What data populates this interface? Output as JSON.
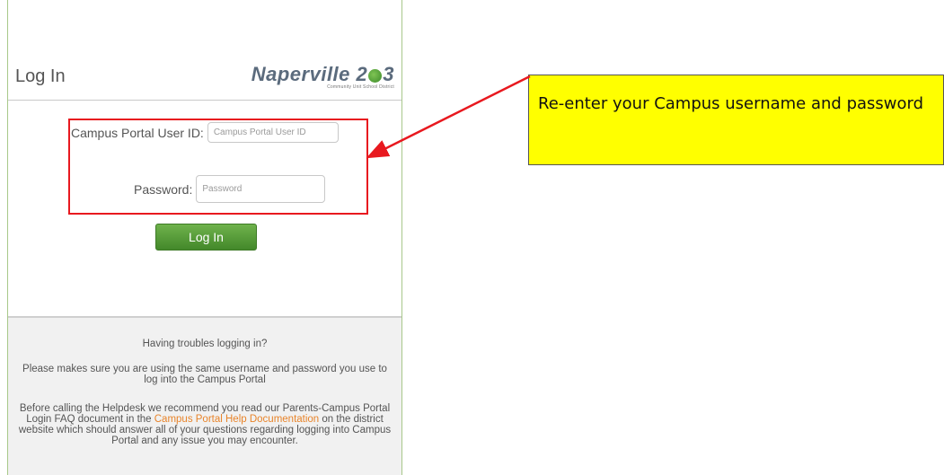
{
  "login": {
    "title": "Log In",
    "logo": {
      "brand_prefix": "Naperville 2",
      "brand_suffix": "3",
      "tagline": "Community Unit School District"
    },
    "user_id": {
      "label": "Campus Portal User ID:",
      "placeholder": "Campus Portal User ID",
      "value": ""
    },
    "password": {
      "label": "Password:",
      "placeholder": "Password",
      "value": ""
    },
    "button_label": "Log In"
  },
  "help": {
    "title": "Having troubles logging in?",
    "paragraph1": "Please makes sure you are using the same username and password you use to log into the Campus Portal",
    "paragraph2_before": "Before calling the Helpdesk we recommend you read our Parents-Campus Portal Login FAQ document in the ",
    "paragraph2_link": "Campus Portal Help Documentation",
    "paragraph2_after": " on the district website which should answer all of your questions regarding logging into Campus Portal and any issue you may encounter."
  },
  "annotation": {
    "callout_text": "Re-enter your Campus username and password",
    "highlight_color": "#e8191f",
    "callout_color": "#ffff00"
  },
  "colors": {
    "button_green": "#5a9e3a",
    "link_orange": "#e8842a",
    "panel_border": "#a8c88a"
  }
}
